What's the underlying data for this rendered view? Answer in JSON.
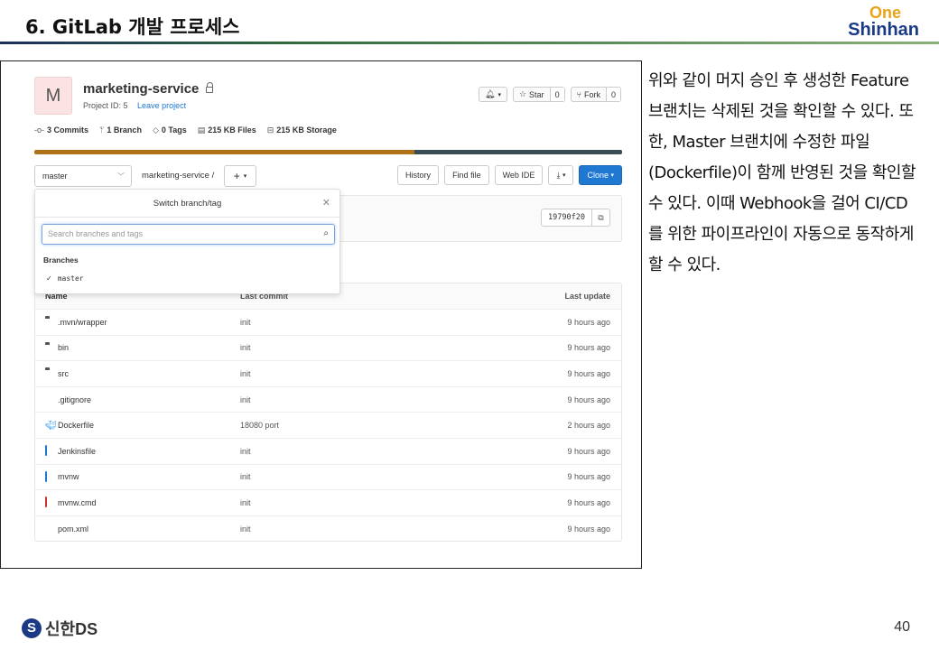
{
  "slide": {
    "title": "6. GitLab 개발 프로세스",
    "brand_one": "One",
    "brand_name": "Shinhan",
    "page_number": "40",
    "footer_logo_text": "신한DS",
    "description": "위와 같이 머지 승인 후 생성한 Feature 브랜치는 삭제된 것을 확인할 수 있다. 또한, Master 브랜치에 수정한 파일(Dockerfile)이 함께 반영된 것을 확인할 수 있다. 이때 Webhook을 걸어 CI/CD를 위한 파이프라인이 자동으로 동작하게 할 수 있다."
  },
  "project": {
    "avatar_letter": "M",
    "name": "marketing-service",
    "project_id": "Project ID: 5",
    "leave_link": "Leave project",
    "notify_count": "",
    "star_label": "Star",
    "star_count": "0",
    "fork_label": "Fork",
    "fork_count": "0"
  },
  "stats": {
    "commits": "3 Commits",
    "branches": "1 Branch",
    "tags": "0 Tags",
    "files": "215 KB Files",
    "storage": "215 KB Storage"
  },
  "language_bar": {
    "colors": [
      "#b07219",
      "#384d54"
    ],
    "fractions": [
      0.647,
      0.353
    ]
  },
  "toolbar": {
    "branch": "master",
    "breadcrumb": "marketing-service  /",
    "plus": "+",
    "history": "History",
    "find_file": "Find file",
    "web_ide": "Web IDE",
    "clone": "Clone"
  },
  "commit": {
    "sha": "19790f20"
  },
  "dropdown": {
    "title": "Switch branch/tag",
    "search_placeholder": "Search branches and tags",
    "section": "Branches",
    "items": [
      "master"
    ]
  },
  "table": {
    "headers": {
      "name": "Name",
      "last_commit": "Last commit",
      "last_update": "Last update"
    },
    "rows": [
      {
        "name": ".mvn/wrapper",
        "icon": "folder-icon",
        "commit": "init",
        "updated": "9 hours ago"
      },
      {
        "name": "bin",
        "icon": "folder-icon",
        "commit": "init",
        "updated": "9 hours ago"
      },
      {
        "name": "src",
        "icon": "folder-icon",
        "commit": "init",
        "updated": "9 hours ago"
      },
      {
        "name": ".gitignore",
        "icon": "git-icon",
        "commit": "init",
        "updated": "9 hours ago"
      },
      {
        "name": "Dockerfile",
        "icon": "docker-icon",
        "commit": "18080 port",
        "updated": "2 hours ago"
      },
      {
        "name": "Jenkinsfile",
        "icon": "file-icon",
        "commit": "init",
        "updated": "9 hours ago"
      },
      {
        "name": "mvnw",
        "icon": "file-icon",
        "commit": "init",
        "updated": "9 hours ago"
      },
      {
        "name": "mvnw.cmd",
        "icon": "cmd-file-icon",
        "commit": "init",
        "updated": "9 hours ago"
      },
      {
        "name": "pom.xml",
        "icon": "xml-file-icon",
        "commit": "init",
        "updated": "9 hours ago"
      }
    ]
  }
}
